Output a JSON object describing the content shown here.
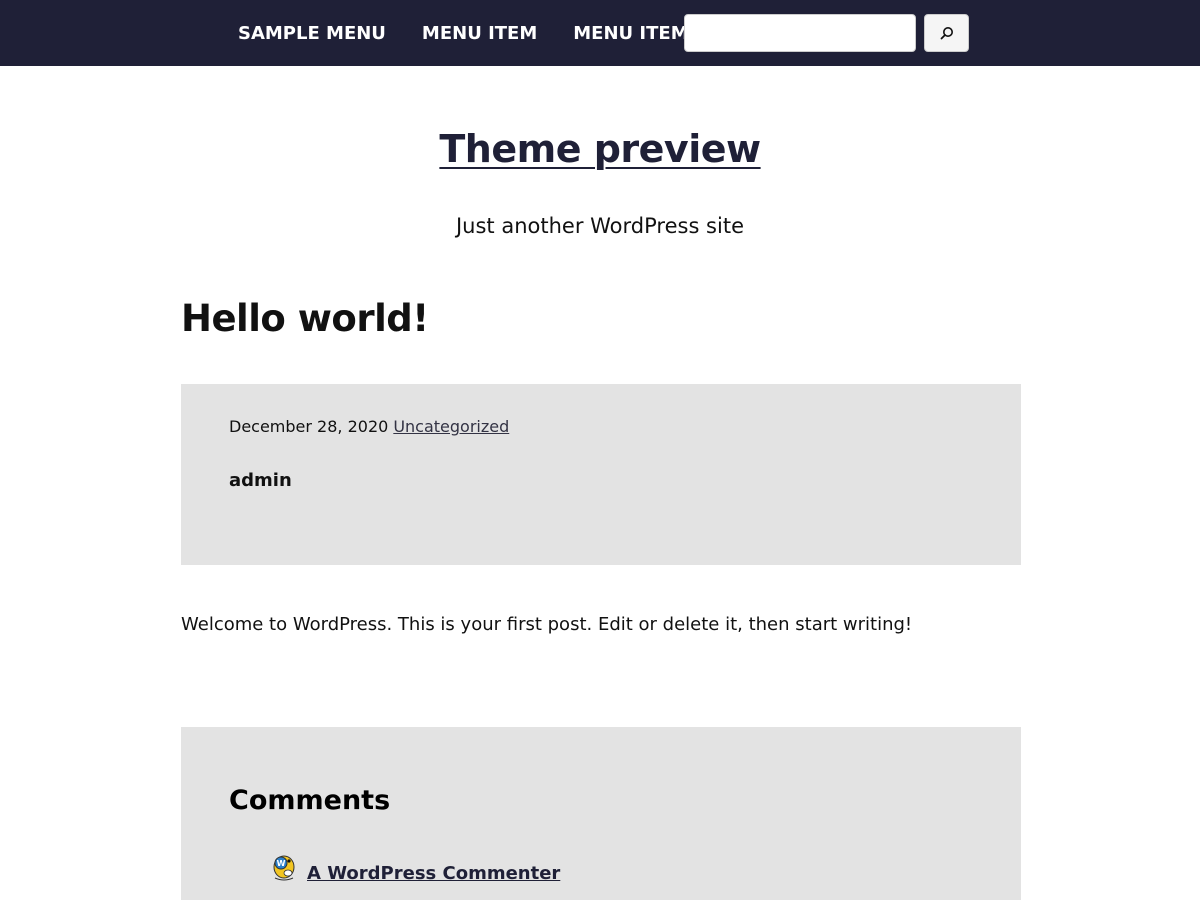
{
  "nav": {
    "items": [
      {
        "label": "SAMPLE MENU"
      },
      {
        "label": "MENU ITEM"
      },
      {
        "label": "MENU ITEM",
        "has_submenu": true
      }
    ],
    "search": {
      "value": "",
      "placeholder": "",
      "button_icon": "search-icon"
    }
  },
  "site": {
    "title": "Theme preview",
    "tagline": "Just another WordPress site"
  },
  "post": {
    "title": "Hello world!",
    "date": "December 28, 2020",
    "category": "Uncategorized",
    "author": "admin",
    "body": "Welcome to WordPress. This is your first post. Edit or delete it, then start writing!"
  },
  "comments": {
    "heading": "Comments",
    "items": [
      {
        "author": "A WordPress Commenter",
        "avatar_icon": "wapuu-avatar-icon"
      }
    ]
  },
  "colors": {
    "nav_background": "#1f2037",
    "panel_background": "#e3e3e3",
    "link": "#1f2037"
  }
}
